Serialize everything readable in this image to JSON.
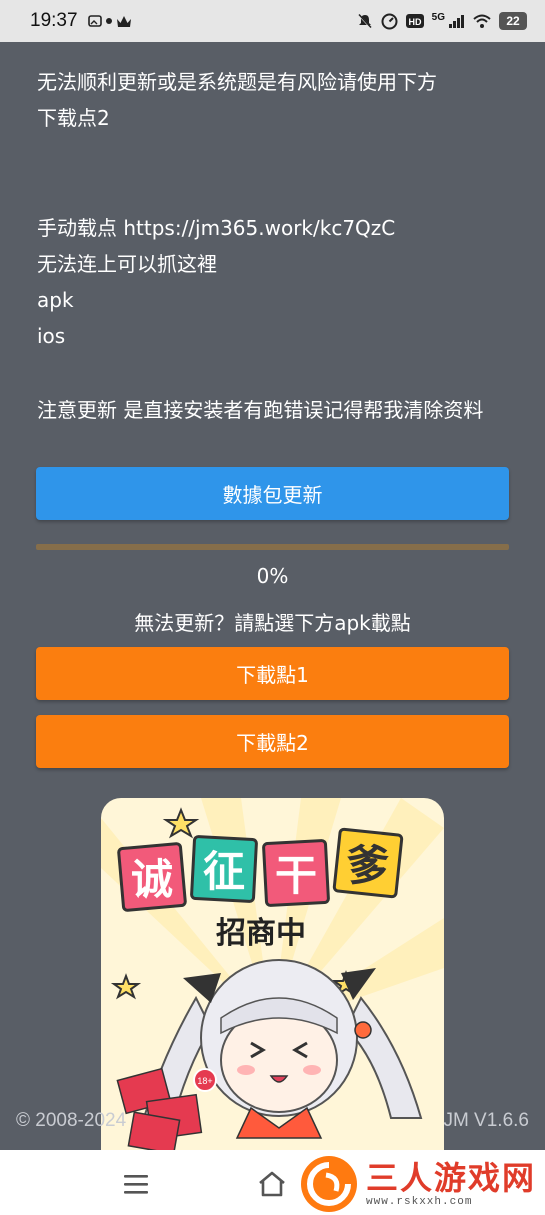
{
  "status_bar": {
    "time": "19:37",
    "network": "5G",
    "battery": "22",
    "icons": [
      "gallery-icon",
      "dot-icon",
      "crown-icon",
      "mute-icon",
      "speed-icon",
      "hd-icon",
      "signal-icon",
      "wifi-icon",
      "battery-icon"
    ]
  },
  "notice": {
    "line1": "无法顺利更新或是系统题是有风险请使用下方",
    "line2": "下载点2",
    "line3": "手动载点 https://jm365.work/kc7QzC",
    "line4": "无法连上可以抓这裡",
    "line5": "apk",
    "line6": "ios",
    "line7": "注意更新 是直接安装者有跑错误记得帮我清除资料"
  },
  "update_button": "數據包更新",
  "progress": {
    "value": 0,
    "label": "0%"
  },
  "fallback_text": "無法更新？請點選下方apk載點",
  "download_buttons": [
    "下載點1",
    "下載點2"
  ],
  "banner": {
    "headline_chars": [
      "诚",
      "征",
      "干",
      "爹"
    ],
    "subtitle": "招商中",
    "badge": "18+"
  },
  "footer": {
    "copyright": "© 2008-2024",
    "version": "JM V1.6.6"
  },
  "navbar": {
    "icons": [
      "menu-icon",
      "home-icon",
      "back-icon"
    ]
  },
  "watermark": {
    "title": "三人游戏网",
    "url": "www.rskxxh.com"
  },
  "colors": {
    "background": "#595e66",
    "blue_button": "#2f95ea",
    "orange_button": "#fb7e0f",
    "progress_track": "#866e4a"
  }
}
